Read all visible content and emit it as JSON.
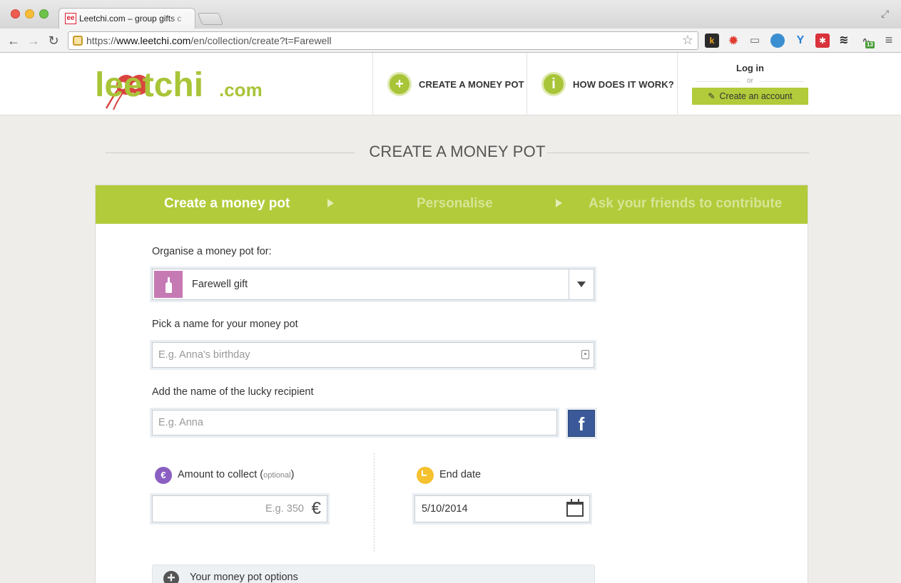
{
  "browser": {
    "tab_title": "Leetchi.com – group gifts c",
    "favicon_text": "ee",
    "url_prefix": "https://",
    "url_host": "www.leetchi.com",
    "url_path": "/en/collection/create?t=Farewell",
    "extension_badge": "13"
  },
  "header": {
    "logo_main": "leetchi",
    "logo_suffix": ".com",
    "nav_create": "CREATE A MONEY POT",
    "nav_how": "HOW DOES IT WORK?",
    "nav_create_icon": "+",
    "nav_how_icon": "i",
    "login": "Log in",
    "or": "or",
    "create_account": "Create an account"
  },
  "page": {
    "title": "CREATE A MONEY POT",
    "steps": [
      {
        "label": "Create a money pot",
        "active": true
      },
      {
        "label": "Personalise",
        "active": false
      },
      {
        "label": "Ask your friends to contribute",
        "active": false
      }
    ]
  },
  "form": {
    "organise_label": "Organise a money pot for:",
    "occasion_value": "Farewell gift",
    "name_label": "Pick a name for your money pot",
    "name_placeholder": "E.g. Anna's birthday",
    "recipient_label": "Add the name of the lucky recipient",
    "recipient_placeholder": "E.g. Anna",
    "facebook_glyph": "f",
    "amount_label": "Amount to collect (",
    "amount_optional": "optional",
    "amount_label_close": ")",
    "amount_icon": "€",
    "amount_placeholder": "E.g. 350",
    "currency_symbol": "€",
    "end_date_label": "End date",
    "end_date_value": "5/10/2014",
    "options_label": "Your money pot options",
    "options_icon": "+"
  },
  "colors": {
    "brand_green": "#b1cb3a",
    "logo_red": "#d9443e",
    "occasion_swatch": "#c67ab4",
    "euro_icon": "#8a5fc1",
    "clock_icon": "#f5c12e",
    "facebook": "#3b5998"
  }
}
